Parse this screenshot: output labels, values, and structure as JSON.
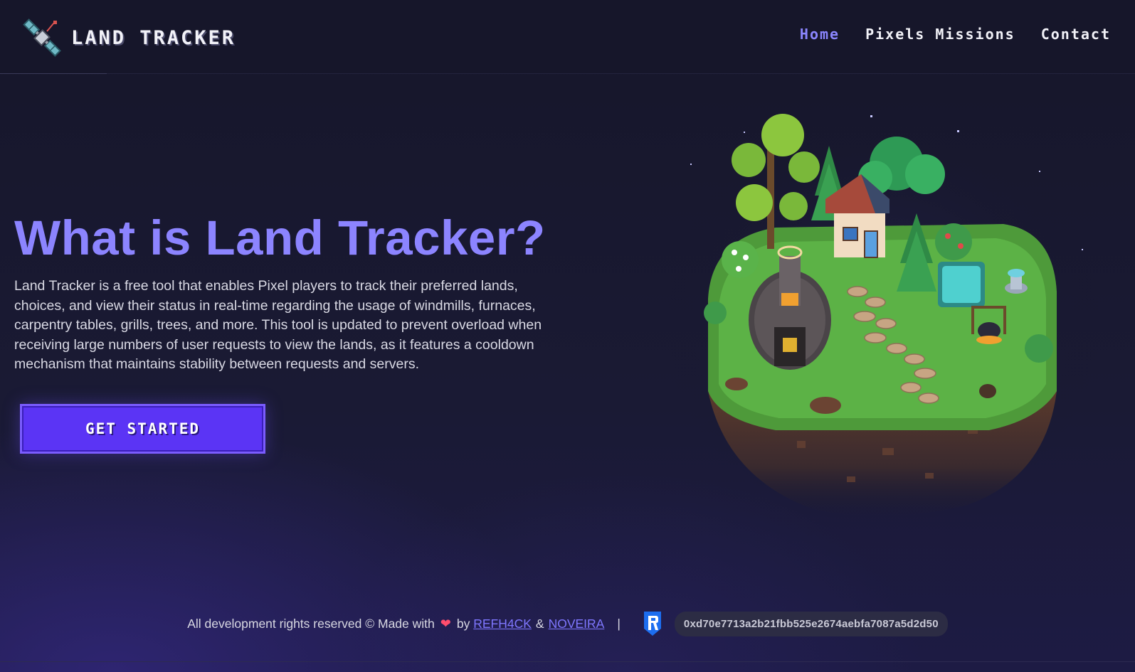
{
  "header": {
    "logo_text": "LAND TRACKER",
    "nav": [
      {
        "label": "Home",
        "active": true
      },
      {
        "label": "Pixels Missions",
        "active": false
      },
      {
        "label": "Contact",
        "active": false
      }
    ]
  },
  "hero": {
    "title": "What is Land Tracker?",
    "description": "Land Tracker is a free tool that enables Pixel players to track their preferred lands, choices, and view their status in real-time regarding the usage of windmills, furnaces, carpentry tables, grills, trees, and more. This tool is updated to prevent overload when receiving large numbers of user requests to view the lands, as it features a cooldown mechanism that maintains stability between requests and servers.",
    "cta_label": "GET STARTED"
  },
  "footer": {
    "rights_text": "All development rights reserved © Made with",
    "by_text": "by",
    "author1": "REFH4CK",
    "amp": "&",
    "author2": "NOVEIRA",
    "separator": "|",
    "wallet_address": "0xd70e7713a2b21fbb525e2674aebfa7087a5d2d50"
  },
  "colors": {
    "accent": "#8c84ff",
    "button": "#5b34f5",
    "background": "#16162a"
  },
  "icons": {
    "logo": "satellite-icon",
    "heart": "heart-icon",
    "wallet": "ronin-wallet-icon",
    "illustration": "floating-island-illustration"
  }
}
